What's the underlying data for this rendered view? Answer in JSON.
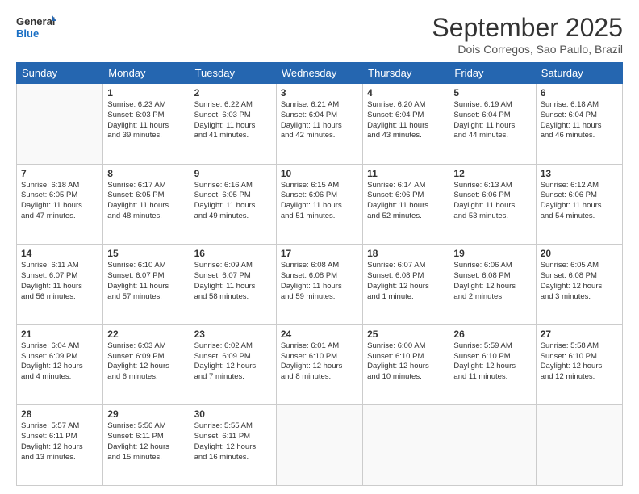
{
  "logo": {
    "line1": "General",
    "line2": "Blue"
  },
  "title": "September 2025",
  "subtitle": "Dois Corregos, Sao Paulo, Brazil",
  "days_of_week": [
    "Sunday",
    "Monday",
    "Tuesday",
    "Wednesday",
    "Thursday",
    "Friday",
    "Saturday"
  ],
  "weeks": [
    [
      {
        "day": "",
        "info": ""
      },
      {
        "day": "1",
        "info": "Sunrise: 6:23 AM\nSunset: 6:03 PM\nDaylight: 11 hours\nand 39 minutes."
      },
      {
        "day": "2",
        "info": "Sunrise: 6:22 AM\nSunset: 6:03 PM\nDaylight: 11 hours\nand 41 minutes."
      },
      {
        "day": "3",
        "info": "Sunrise: 6:21 AM\nSunset: 6:04 PM\nDaylight: 11 hours\nand 42 minutes."
      },
      {
        "day": "4",
        "info": "Sunrise: 6:20 AM\nSunset: 6:04 PM\nDaylight: 11 hours\nand 43 minutes."
      },
      {
        "day": "5",
        "info": "Sunrise: 6:19 AM\nSunset: 6:04 PM\nDaylight: 11 hours\nand 44 minutes."
      },
      {
        "day": "6",
        "info": "Sunrise: 6:18 AM\nSunset: 6:04 PM\nDaylight: 11 hours\nand 46 minutes."
      }
    ],
    [
      {
        "day": "7",
        "info": "Sunrise: 6:18 AM\nSunset: 6:05 PM\nDaylight: 11 hours\nand 47 minutes."
      },
      {
        "day": "8",
        "info": "Sunrise: 6:17 AM\nSunset: 6:05 PM\nDaylight: 11 hours\nand 48 minutes."
      },
      {
        "day": "9",
        "info": "Sunrise: 6:16 AM\nSunset: 6:05 PM\nDaylight: 11 hours\nand 49 minutes."
      },
      {
        "day": "10",
        "info": "Sunrise: 6:15 AM\nSunset: 6:06 PM\nDaylight: 11 hours\nand 51 minutes."
      },
      {
        "day": "11",
        "info": "Sunrise: 6:14 AM\nSunset: 6:06 PM\nDaylight: 11 hours\nand 52 minutes."
      },
      {
        "day": "12",
        "info": "Sunrise: 6:13 AM\nSunset: 6:06 PM\nDaylight: 11 hours\nand 53 minutes."
      },
      {
        "day": "13",
        "info": "Sunrise: 6:12 AM\nSunset: 6:06 PM\nDaylight: 11 hours\nand 54 minutes."
      }
    ],
    [
      {
        "day": "14",
        "info": "Sunrise: 6:11 AM\nSunset: 6:07 PM\nDaylight: 11 hours\nand 56 minutes."
      },
      {
        "day": "15",
        "info": "Sunrise: 6:10 AM\nSunset: 6:07 PM\nDaylight: 11 hours\nand 57 minutes."
      },
      {
        "day": "16",
        "info": "Sunrise: 6:09 AM\nSunset: 6:07 PM\nDaylight: 11 hours\nand 58 minutes."
      },
      {
        "day": "17",
        "info": "Sunrise: 6:08 AM\nSunset: 6:08 PM\nDaylight: 11 hours\nand 59 minutes."
      },
      {
        "day": "18",
        "info": "Sunrise: 6:07 AM\nSunset: 6:08 PM\nDaylight: 12 hours\nand 1 minute."
      },
      {
        "day": "19",
        "info": "Sunrise: 6:06 AM\nSunset: 6:08 PM\nDaylight: 12 hours\nand 2 minutes."
      },
      {
        "day": "20",
        "info": "Sunrise: 6:05 AM\nSunset: 6:08 PM\nDaylight: 12 hours\nand 3 minutes."
      }
    ],
    [
      {
        "day": "21",
        "info": "Sunrise: 6:04 AM\nSunset: 6:09 PM\nDaylight: 12 hours\nand 4 minutes."
      },
      {
        "day": "22",
        "info": "Sunrise: 6:03 AM\nSunset: 6:09 PM\nDaylight: 12 hours\nand 6 minutes."
      },
      {
        "day": "23",
        "info": "Sunrise: 6:02 AM\nSunset: 6:09 PM\nDaylight: 12 hours\nand 7 minutes."
      },
      {
        "day": "24",
        "info": "Sunrise: 6:01 AM\nSunset: 6:10 PM\nDaylight: 12 hours\nand 8 minutes."
      },
      {
        "day": "25",
        "info": "Sunrise: 6:00 AM\nSunset: 6:10 PM\nDaylight: 12 hours\nand 10 minutes."
      },
      {
        "day": "26",
        "info": "Sunrise: 5:59 AM\nSunset: 6:10 PM\nDaylight: 12 hours\nand 11 minutes."
      },
      {
        "day": "27",
        "info": "Sunrise: 5:58 AM\nSunset: 6:10 PM\nDaylight: 12 hours\nand 12 minutes."
      }
    ],
    [
      {
        "day": "28",
        "info": "Sunrise: 5:57 AM\nSunset: 6:11 PM\nDaylight: 12 hours\nand 13 minutes."
      },
      {
        "day": "29",
        "info": "Sunrise: 5:56 AM\nSunset: 6:11 PM\nDaylight: 12 hours\nand 15 minutes."
      },
      {
        "day": "30",
        "info": "Sunrise: 5:55 AM\nSunset: 6:11 PM\nDaylight: 12 hours\nand 16 minutes."
      },
      {
        "day": "",
        "info": ""
      },
      {
        "day": "",
        "info": ""
      },
      {
        "day": "",
        "info": ""
      },
      {
        "day": "",
        "info": ""
      }
    ]
  ]
}
